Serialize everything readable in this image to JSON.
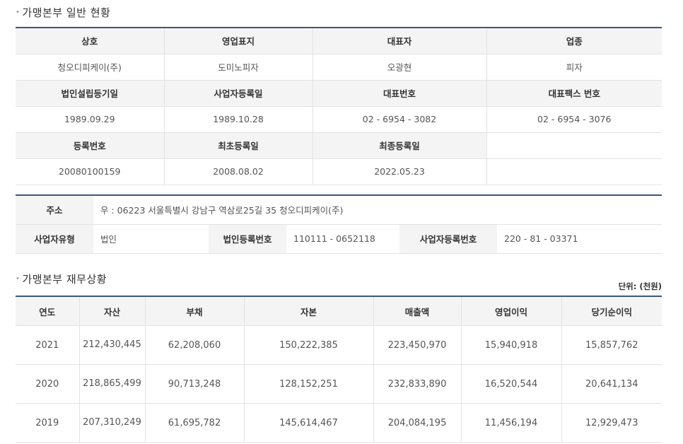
{
  "sections": {
    "general_title": "가맹본부 일반 현황",
    "finance_title": "가맹본부 재무상황",
    "unit": "단위: (천원)"
  },
  "general": {
    "row1_headers": [
      "상호",
      "영업표지",
      "대표자",
      "업종"
    ],
    "row1_values": [
      "청오디피케이(주)",
      "도미노피자",
      "오광현",
      "피자"
    ],
    "row2_headers": [
      "법인설립등기일",
      "사업자등록일",
      "대표번호",
      "대표팩스 번호"
    ],
    "row2_values": [
      "1989.09.29",
      "1989.10.28",
      "02 - 6954 - 3082",
      "02 - 6954 - 3076"
    ],
    "row3_headers": [
      "등록번호",
      "최초등록일",
      "최종등록일",
      ""
    ],
    "row3_values": [
      "20080100159",
      "2008.08.02",
      "2022.05.23",
      ""
    ]
  },
  "address": {
    "address_label": "주소",
    "address_value": "우 : 06223 서울특별시 강남구 역삼로25길 35 청오디피케이(주)",
    "biz_type_label": "사업자유형",
    "biz_type_value": "법인",
    "corp_no_label": "법인등록번호",
    "corp_no_value": "110111 - 0652118",
    "biz_no_label": "사업자등록번호",
    "biz_no_value": "220 - 81 - 03371"
  },
  "finance": {
    "headers": [
      "연도",
      "자산",
      "부채",
      "자본",
      "매출액",
      "영업이익",
      "당기순이익"
    ],
    "rows": [
      [
        "2021",
        "212,430,445",
        "62,208,060",
        "150,222,385",
        "223,450,970",
        "15,940,918",
        "15,857,762"
      ],
      [
        "2020",
        "218,865,499",
        "90,713,248",
        "128,152,251",
        "232,833,890",
        "16,520,544",
        "20,641,134"
      ],
      [
        "2019",
        "207,310,249",
        "61,695,782",
        "145,614,467",
        "204,084,195",
        "11,456,194",
        "12,929,473"
      ]
    ]
  }
}
